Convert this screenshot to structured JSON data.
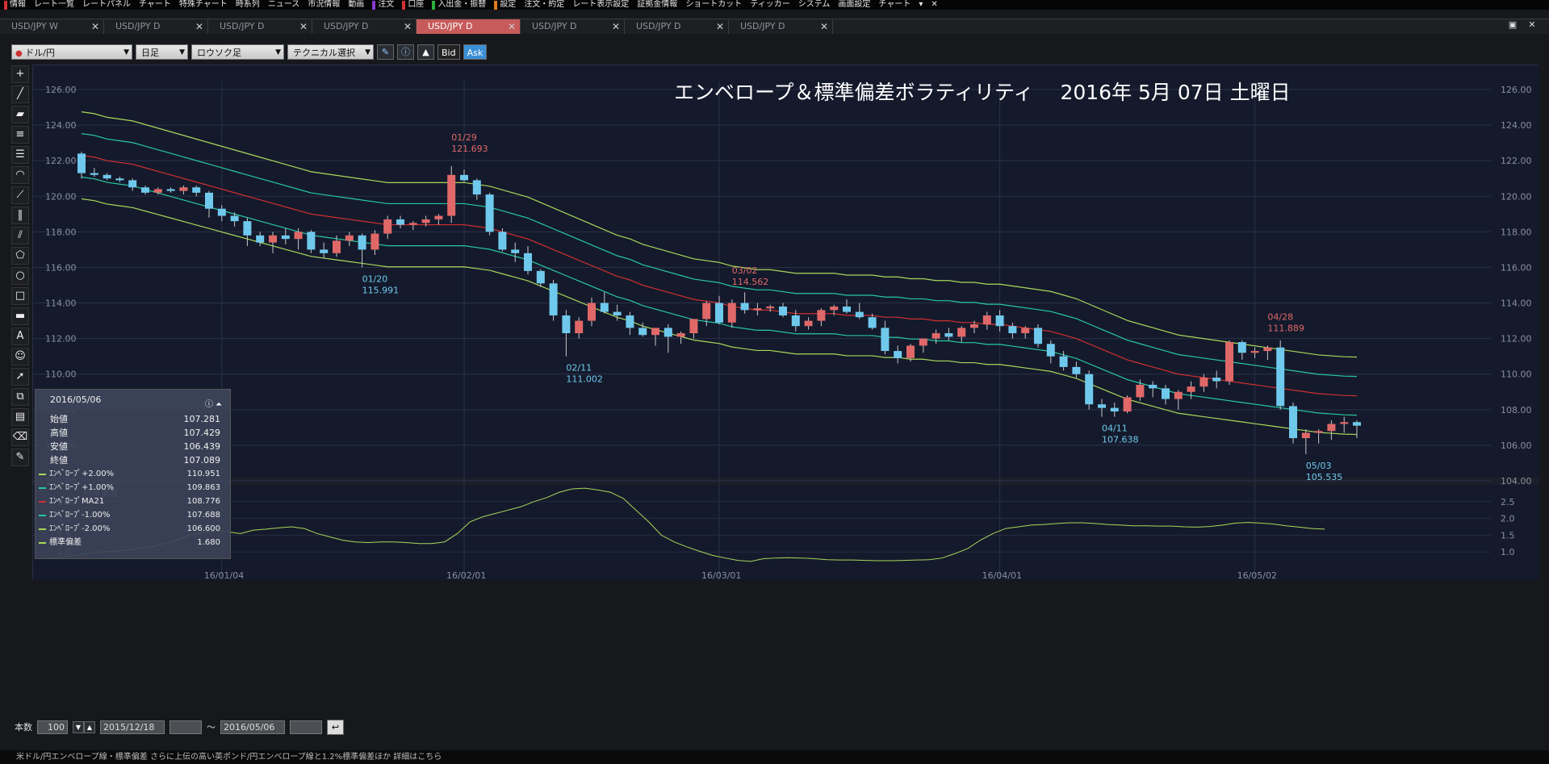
{
  "menubar": {
    "items": [
      {
        "label": "情報",
        "mark": "#d43030"
      },
      {
        "label": "レート一覧",
        "mark": ""
      },
      {
        "label": "レートパネル",
        "mark": ""
      },
      {
        "label": "チャート",
        "mark": ""
      },
      {
        "label": "特殊チャート",
        "mark": ""
      },
      {
        "label": "時系列",
        "mark": ""
      },
      {
        "label": "ニュース",
        "mark": ""
      },
      {
        "label": "市況情報",
        "mark": ""
      },
      {
        "label": "動画",
        "mark": ""
      },
      {
        "label": "注文",
        "mark": "#8a3ad4"
      },
      {
        "label": "口座",
        "mark": "#d43030"
      },
      {
        "label": "入出金・振替",
        "mark": "#2fae3a"
      },
      {
        "label": "設定",
        "mark": "#e07a20"
      },
      {
        "label": "注文・約定",
        "mark": ""
      },
      {
        "label": "レート表示設定",
        "mark": ""
      },
      {
        "label": "証拠金情報",
        "mark": ""
      },
      {
        "label": "ショートカット",
        "mark": ""
      },
      {
        "label": "ティッカー",
        "mark": ""
      },
      {
        "label": "システム",
        "mark": ""
      },
      {
        "label": "画面設定",
        "mark": ""
      },
      {
        "label": "チャート",
        "mark": ""
      },
      {
        "label": "▾",
        "mark": ""
      },
      {
        "label": "✕",
        "mark": ""
      }
    ]
  },
  "tabs": [
    {
      "label": "USD/JPY W",
      "active": false
    },
    {
      "label": "USD/JPY D",
      "active": false
    },
    {
      "label": "USD/JPY D",
      "active": false
    },
    {
      "label": "USD/JPY D",
      "active": false
    },
    {
      "label": "USD/JPY D",
      "active": true
    },
    {
      "label": "USD/JPY D",
      "active": false
    },
    {
      "label": "USD/JPY D",
      "active": false
    },
    {
      "label": "USD/JPY D",
      "active": false
    }
  ],
  "toolbar": {
    "pair": "ドル/円",
    "period": "日足",
    "chart_type": "ロウソク足",
    "tech": "テクニカル選択",
    "bid": "Bid",
    "ask": "Ask"
  },
  "left_tools": [
    {
      "name": "crosshair-icon",
      "glyph": "+"
    },
    {
      "name": "trendline-icon",
      "glyph": "╱"
    },
    {
      "name": "ruler-icon",
      "glyph": "▰"
    },
    {
      "name": "hlines-icon",
      "glyph": "≡"
    },
    {
      "name": "multi-hlines-icon",
      "glyph": "☰"
    },
    {
      "name": "arc-icon",
      "glyph": "◠"
    },
    {
      "name": "fan-icon",
      "glyph": "⟋"
    },
    {
      "name": "vlines-icon",
      "glyph": "‖"
    },
    {
      "name": "channel-icon",
      "glyph": "⫽"
    },
    {
      "name": "pentagon-icon",
      "glyph": "⬠"
    },
    {
      "name": "circle-icon",
      "glyph": "○"
    },
    {
      "name": "rectangle-icon",
      "glyph": "□"
    },
    {
      "name": "line-width-icon",
      "glyph": "▬"
    },
    {
      "name": "text-icon",
      "glyph": "A"
    },
    {
      "name": "smiley-icon",
      "glyph": "☺"
    },
    {
      "name": "pointer-icon",
      "glyph": "➚"
    },
    {
      "name": "copy-icon",
      "glyph": "⧉"
    },
    {
      "name": "layers-icon",
      "glyph": "▤"
    },
    {
      "name": "eraser-icon",
      "glyph": "⌫"
    },
    {
      "name": "pencil-icon",
      "glyph": "✎"
    }
  ],
  "chart_title": "エンベロープ＆標準偏差ボラティリティ　 2016年 5月 07日 土曜日",
  "info": {
    "date": "2016/05/06",
    "rows": [
      {
        "label": "始値",
        "value": "107.281"
      },
      {
        "label": "高値",
        "value": "107.429"
      },
      {
        "label": "安値",
        "value": "106.439"
      },
      {
        "label": "終値",
        "value": "107.089"
      }
    ],
    "indicators": [
      {
        "label": "ｴﾝﾍﾞﾛｰﾌﾟ+2.00%",
        "value": "110.951",
        "color": "#a8d85a"
      },
      {
        "label": "ｴﾝﾍﾞﾛｰﾌﾟ+1.00%",
        "value": "109.863",
        "color": "#28c8a0"
      },
      {
        "label": "ｴﾝﾍﾞﾛｰﾌﾟMA21",
        "value": "108.776",
        "color": "#d03030"
      },
      {
        "label": "ｴﾝﾍﾞﾛｰﾌﾟ-1.00%",
        "value": "107.688",
        "color": "#28c8a0"
      },
      {
        "label": "ｴﾝﾍﾞﾛｰﾌﾟ-2.00%",
        "value": "106.600",
        "color": "#a8d85a"
      },
      {
        "label": "標準偏差",
        "value": "1.680",
        "color": "#a8d85a"
      }
    ]
  },
  "chart_data": [
    {
      "type": "candlestick",
      "ylim": [
        104,
        126
      ],
      "yticks": [
        "126.00",
        "124.00",
        "122.00",
        "120.00",
        "118.00",
        "116.00",
        "114.00",
        "112.00",
        "110.00",
        "108.00",
        "106.00",
        "104.00"
      ],
      "xticks": [
        "16/01/04",
        "16/02/01",
        "16/03/01",
        "16/04/01",
        "16/05/02"
      ],
      "candles": [
        [
          122.4,
          122.5,
          121.0,
          121.3
        ],
        [
          121.3,
          121.6,
          121.1,
          121.2
        ],
        [
          121.2,
          121.3,
          120.9,
          121.0
        ],
        [
          121.0,
          121.1,
          120.8,
          120.9
        ],
        [
          120.9,
          121.0,
          120.3,
          120.5
        ],
        [
          120.5,
          120.6,
          120.1,
          120.2
        ],
        [
          120.2,
          120.5,
          120.1,
          120.4
        ],
        [
          120.4,
          120.5,
          120.2,
          120.3
        ],
        [
          120.3,
          120.6,
          120.1,
          120.5
        ],
        [
          120.5,
          120.6,
          120.0,
          120.2
        ],
        [
          120.2,
          120.3,
          118.8,
          119.3
        ],
        [
          119.3,
          119.5,
          118.6,
          118.9
        ],
        [
          118.9,
          119.1,
          118.3,
          118.6
        ],
        [
          118.6,
          118.8,
          117.2,
          117.8
        ],
        [
          117.8,
          118.0,
          117.2,
          117.4
        ],
        [
          117.4,
          118.0,
          116.8,
          117.8
        ],
        [
          117.8,
          118.2,
          117.3,
          117.6
        ],
        [
          117.6,
          118.2,
          117.0,
          118.0
        ],
        [
          118.0,
          118.1,
          116.8,
          117.0
        ],
        [
          117.0,
          117.4,
          116.5,
          116.8
        ],
        [
          116.8,
          117.8,
          116.6,
          117.5
        ],
        [
          117.5,
          118.0,
          117.2,
          117.8
        ],
        [
          117.8,
          117.9,
          116.0,
          117.0
        ],
        [
          117.0,
          118.1,
          116.7,
          117.9
        ],
        [
          117.9,
          118.9,
          117.6,
          118.7
        ],
        [
          118.7,
          118.9,
          118.2,
          118.4
        ],
        [
          118.4,
          118.6,
          118.1,
          118.5
        ],
        [
          118.5,
          118.9,
          118.3,
          118.7
        ],
        [
          118.7,
          119.0,
          118.4,
          118.9
        ],
        [
          118.9,
          121.7,
          118.5,
          121.2
        ],
        [
          121.2,
          121.5,
          120.8,
          120.9
        ],
        [
          120.9,
          121.0,
          119.8,
          120.1
        ],
        [
          120.1,
          120.2,
          117.8,
          118.0
        ],
        [
          118.0,
          118.2,
          116.9,
          117.0
        ],
        [
          117.0,
          117.4,
          116.3,
          116.8
        ],
        [
          116.8,
          117.2,
          115.6,
          115.8
        ],
        [
          115.8,
          115.9,
          114.9,
          115.1
        ],
        [
          115.1,
          115.3,
          113.0,
          113.3
        ],
        [
          113.3,
          113.6,
          111.0,
          112.3
        ],
        [
          112.3,
          113.2,
          112.0,
          113.0
        ],
        [
          113.0,
          114.3,
          112.7,
          114.0
        ],
        [
          114.0,
          114.6,
          113.4,
          113.5
        ],
        [
          113.5,
          113.9,
          113.0,
          113.3
        ],
        [
          113.3,
          113.5,
          112.2,
          112.6
        ],
        [
          112.6,
          112.9,
          112.1,
          112.2
        ],
        [
          112.2,
          112.6,
          111.6,
          112.6
        ],
        [
          112.6,
          112.8,
          111.2,
          112.1
        ],
        [
          112.1,
          112.4,
          111.7,
          112.3
        ],
        [
          112.3,
          113.1,
          112.0,
          113.1
        ],
        [
          113.1,
          114.1,
          112.7,
          114.0
        ],
        [
          114.0,
          114.4,
          112.8,
          112.9
        ],
        [
          112.9,
          114.2,
          112.6,
          114.0
        ],
        [
          114.0,
          114.6,
          113.4,
          113.6
        ],
        [
          113.6,
          114.0,
          113.3,
          113.7
        ],
        [
          113.7,
          113.9,
          113.5,
          113.8
        ],
        [
          113.8,
          114.0,
          113.2,
          113.3
        ],
        [
          113.3,
          113.6,
          112.4,
          112.7
        ],
        [
          112.7,
          113.2,
          112.5,
          113.0
        ],
        [
          113.0,
          113.7,
          112.7,
          113.6
        ],
        [
          113.6,
          113.9,
          113.3,
          113.8
        ],
        [
          113.8,
          114.2,
          113.4,
          113.5
        ],
        [
          113.5,
          114.0,
          113.1,
          113.2
        ],
        [
          113.2,
          113.4,
          112.5,
          112.6
        ],
        [
          112.6,
          113.0,
          111.1,
          111.3
        ],
        [
          111.3,
          111.6,
          110.6,
          110.9
        ],
        [
          110.9,
          111.7,
          110.7,
          111.6
        ],
        [
          111.6,
          111.9,
          111.2,
          112.0
        ],
        [
          112.0,
          112.5,
          111.7,
          112.3
        ],
        [
          112.3,
          112.6,
          111.9,
          112.1
        ],
        [
          112.1,
          112.7,
          111.8,
          112.6
        ],
        [
          112.6,
          113.0,
          112.3,
          112.8
        ],
        [
          112.8,
          113.5,
          112.5,
          113.3
        ],
        [
          113.3,
          113.6,
          112.4,
          112.7
        ],
        [
          112.7,
          112.9,
          112.0,
          112.3
        ],
        [
          112.3,
          112.7,
          112.0,
          112.6
        ],
        [
          112.6,
          112.8,
          111.5,
          111.7
        ],
        [
          111.7,
          111.9,
          110.6,
          111.0
        ],
        [
          111.0,
          111.3,
          110.2,
          110.4
        ],
        [
          110.4,
          110.7,
          109.8,
          110.0
        ],
        [
          110.0,
          110.2,
          108.0,
          108.3
        ],
        [
          108.3,
          108.6,
          107.6,
          108.1
        ],
        [
          108.1,
          108.4,
          107.6,
          107.9
        ],
        [
          107.9,
          108.8,
          107.8,
          108.7
        ],
        [
          108.7,
          109.7,
          108.5,
          109.4
        ],
        [
          109.4,
          109.6,
          108.7,
          109.2
        ],
        [
          109.2,
          109.4,
          108.3,
          108.6
        ],
        [
          108.6,
          109.1,
          108.0,
          109.0
        ],
        [
          109.0,
          109.6,
          108.6,
          109.3
        ],
        [
          109.3,
          110.0,
          109.0,
          109.8
        ],
        [
          109.8,
          110.2,
          109.2,
          109.6
        ],
        [
          109.6,
          111.9,
          109.4,
          111.8
        ],
        [
          111.8,
          111.9,
          110.8,
          111.2
        ],
        [
          111.2,
          111.5,
          110.9,
          111.3
        ],
        [
          111.3,
          111.6,
          110.8,
          111.5
        ],
        [
          111.5,
          111.9,
          108.0,
          108.2
        ],
        [
          108.2,
          108.4,
          106.1,
          106.4
        ],
        [
          106.4,
          106.9,
          105.5,
          106.7
        ],
        [
          106.7,
          106.9,
          106.1,
          106.8
        ],
        [
          106.8,
          107.4,
          106.3,
          107.2
        ],
        [
          107.2,
          107.6,
          106.7,
          107.3
        ],
        [
          107.3,
          107.4,
          106.4,
          107.1
        ]
      ],
      "envelope": {
        "ma21": [
          122.3,
          122.2,
          122.0,
          121.9,
          121.8,
          121.6,
          121.4,
          121.2,
          121.0,
          120.8,
          120.6,
          120.4,
          120.2,
          120.0,
          119.8,
          119.6,
          119.4,
          119.2,
          119.0,
          118.9,
          118.8,
          118.7,
          118.6,
          118.5,
          118.4,
          118.4,
          118.4,
          118.4,
          118.4,
          118.4,
          118.4,
          118.3,
          118.2,
          118.0,
          117.8,
          117.6,
          117.3,
          117.0,
          116.7,
          116.4,
          116.1,
          115.8,
          115.5,
          115.3,
          115.0,
          114.8,
          114.6,
          114.4,
          114.2,
          114.1,
          114.0,
          113.8,
          113.7,
          113.6,
          113.6,
          113.5,
          113.4,
          113.4,
          113.4,
          113.4,
          113.3,
          113.3,
          113.3,
          113.2,
          113.2,
          113.1,
          113.1,
          113.0,
          113.0,
          112.9,
          112.9,
          112.8,
          112.8,
          112.7,
          112.6,
          112.5,
          112.4,
          112.2,
          112.0,
          111.7,
          111.4,
          111.1,
          110.8,
          110.6,
          110.4,
          110.2,
          110.0,
          109.9,
          109.8,
          109.7,
          109.6,
          109.5,
          109.4,
          109.3,
          109.2,
          109.1,
          109.0,
          108.9,
          108.85,
          108.8,
          108.78
        ],
        "pct": 1.0
      },
      "annotations": [
        {
          "date": "01/29",
          "value": "121.693",
          "kind": "high",
          "index": 29
        },
        {
          "date": "01/20",
          "value": "115.991",
          "kind": "low",
          "index": 22
        },
        {
          "date": "03/02",
          "value": "114.562",
          "kind": "high",
          "index": 51
        },
        {
          "date": "02/11",
          "value": "111.002",
          "kind": "low",
          "index": 38
        },
        {
          "date": "04/11",
          "value": "107.638",
          "kind": "low",
          "index": 80
        },
        {
          "date": "04/28",
          "value": "111.889",
          "kind": "high",
          "index": 93
        },
        {
          "date": "05/03",
          "value": "105.535",
          "kind": "low",
          "index": 96
        }
      ]
    },
    {
      "type": "line",
      "label": "標準偏差",
      "ylim": [
        0.5,
        3.0
      ],
      "yticks": [
        "2.5",
        "2.0",
        "1.5",
        "1.0"
      ],
      "values": [
        0.8,
        0.85,
        0.9,
        0.95,
        1.0,
        1.02,
        1.05,
        1.1,
        1.15,
        1.25,
        1.35,
        1.5,
        1.58,
        1.62,
        1.6,
        1.55,
        1.65,
        1.68,
        1.72,
        1.75,
        1.7,
        1.55,
        1.45,
        1.35,
        1.3,
        1.28,
        1.3,
        1.3,
        1.28,
        1.25,
        1.25,
        1.3,
        1.55,
        1.9,
        2.05,
        2.15,
        2.25,
        2.35,
        2.5,
        2.62,
        2.78,
        2.88,
        2.9,
        2.85,
        2.78,
        2.6,
        2.25,
        1.9,
        1.5,
        1.3,
        1.15,
        1.02,
        0.9,
        0.82,
        0.75,
        0.72,
        0.8,
        0.82,
        0.83,
        0.82,
        0.8,
        0.77,
        0.76,
        0.76,
        0.75,
        0.74,
        0.74,
        0.75,
        0.76,
        0.77,
        0.82,
        0.95,
        1.1,
        1.35,
        1.55,
        1.7,
        1.75,
        1.8,
        1.82,
        1.85,
        1.87,
        1.87,
        1.85,
        1.82,
        1.8,
        1.78,
        1.78,
        1.77,
        1.77,
        1.75,
        1.74,
        1.76,
        1.8,
        1.86,
        1.88,
        1.86,
        1.83,
        1.78,
        1.74,
        1.7,
        1.68
      ]
    }
  ],
  "bottom": {
    "count_label": "本数",
    "count": "100",
    "from": "2015/12/18",
    "tilde": "〜",
    "to": "2016/05/06"
  },
  "status": "米ドル/円エンベロープ線・標準偏差 さらに上伝の高い英ポンド/円エンベロープ線と1.2%標準偏差ほか 詳細はこちら"
}
